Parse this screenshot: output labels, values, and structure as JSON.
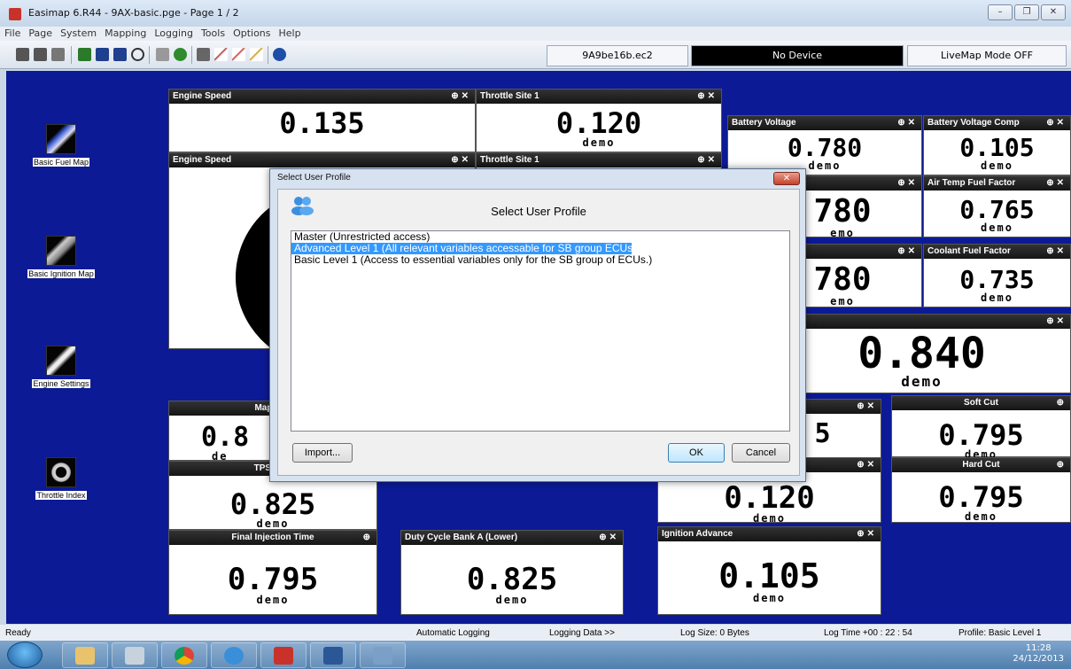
{
  "window": {
    "title": "Easimap 6.R44 - 9AX-basic.pge - Page 1 / 2",
    "controls": [
      "–",
      "❐",
      "✕"
    ]
  },
  "menu": [
    "File",
    "Page",
    "System",
    "Mapping",
    "Logging",
    "Tools",
    "Options",
    "Help"
  ],
  "toolbar": {
    "ecu_file": "9A9be16b.ec2",
    "device": "No Device",
    "livemap": "LiveMap Mode OFF"
  },
  "desktop_icons": [
    {
      "label": "Basic Fuel Map",
      "icon": "fuel-injector-icon"
    },
    {
      "label": "Basic Ignition Map",
      "icon": "spark-plug-icon"
    },
    {
      "label": "Engine Settings",
      "icon": "wrench-icon"
    },
    {
      "label": "Throttle Index",
      "icon": "throttle-body-icon"
    }
  ],
  "gauges": {
    "engine_speed_1": {
      "title": "Engine Speed",
      "value": "0.135"
    },
    "throttle_site_1": {
      "title": "Throttle Site 1",
      "value": "0.120",
      "demo": "demo"
    },
    "engine_speed_2": {
      "title": "Engine Speed"
    },
    "throttle_site_2": {
      "title": "Throttle Site 1"
    },
    "battery_voltage": {
      "title": "Battery Voltage",
      "value": "0.780",
      "demo": "demo"
    },
    "battery_voltage_comp": {
      "title": "Battery Voltage Comp",
      "value": "0.105",
      "demo": "demo"
    },
    "hidden_r2": {
      "value": "780",
      "demo": "emo"
    },
    "air_temp_fuel": {
      "title": "Air Temp Fuel Factor",
      "value": "0.765",
      "demo": "demo"
    },
    "hidden_r3": {
      "value": "780",
      "demo": "emo"
    },
    "coolant_fuel": {
      "title": "Coolant Fuel Factor",
      "value": "0.735",
      "demo": "demo"
    },
    "big": {
      "value": "0.840",
      "demo": "demo"
    },
    "mapping": {
      "title": "Mapping",
      "value": "0.8",
      "demo": "de"
    },
    "tps_fuel": {
      "title": "TPS Fuel",
      "value": "0.825",
      "demo": "demo"
    },
    "hidden_mid1": {
      "value": "5"
    },
    "soft_cut": {
      "title": "Soft Cut",
      "value": "0.795",
      "demo": "demo"
    },
    "hidden_mid2": {
      "value": "0.120",
      "demo": "demo"
    },
    "hard_cut": {
      "title": "Hard Cut",
      "value": "0.795",
      "demo": "demo"
    },
    "final_injection": {
      "title": "Final Injection Time",
      "value": "0.795",
      "demo": "demo"
    },
    "duty_cycle": {
      "title": "Duty Cycle Bank A (Lower)",
      "value": "0.825",
      "demo": "demo"
    },
    "ignition_advance": {
      "title": "Ignition Advance",
      "value": "0.105",
      "demo": "demo"
    }
  },
  "dialog": {
    "title": "Select User Profile",
    "heading": "Select User Profile",
    "options": [
      "Master (Unrestricted access)",
      "Advanced Level 1 (All relevant variables accessable for SB group ECUs.)",
      "Basic Level 1 (Access to essential variables only for the SB group of ECUs.)"
    ],
    "selected_index": 1,
    "import_label": "Import...",
    "ok_label": "OK",
    "cancel_label": "Cancel"
  },
  "statusbar": {
    "ready": "Ready",
    "auto_logging": "Automatic Logging",
    "logging_data": "Logging Data >>",
    "log_size": "Log Size: 0 Bytes",
    "log_time": "Log Time +00 : 22 : 54",
    "profile": "Profile: Basic Level 1"
  },
  "tray": {
    "time": "11:28",
    "date": "24/12/2013"
  },
  "colors": {
    "desktop": "#0c1a96",
    "gauge_header": "#1e1e1e",
    "selection": "#3399ff"
  }
}
